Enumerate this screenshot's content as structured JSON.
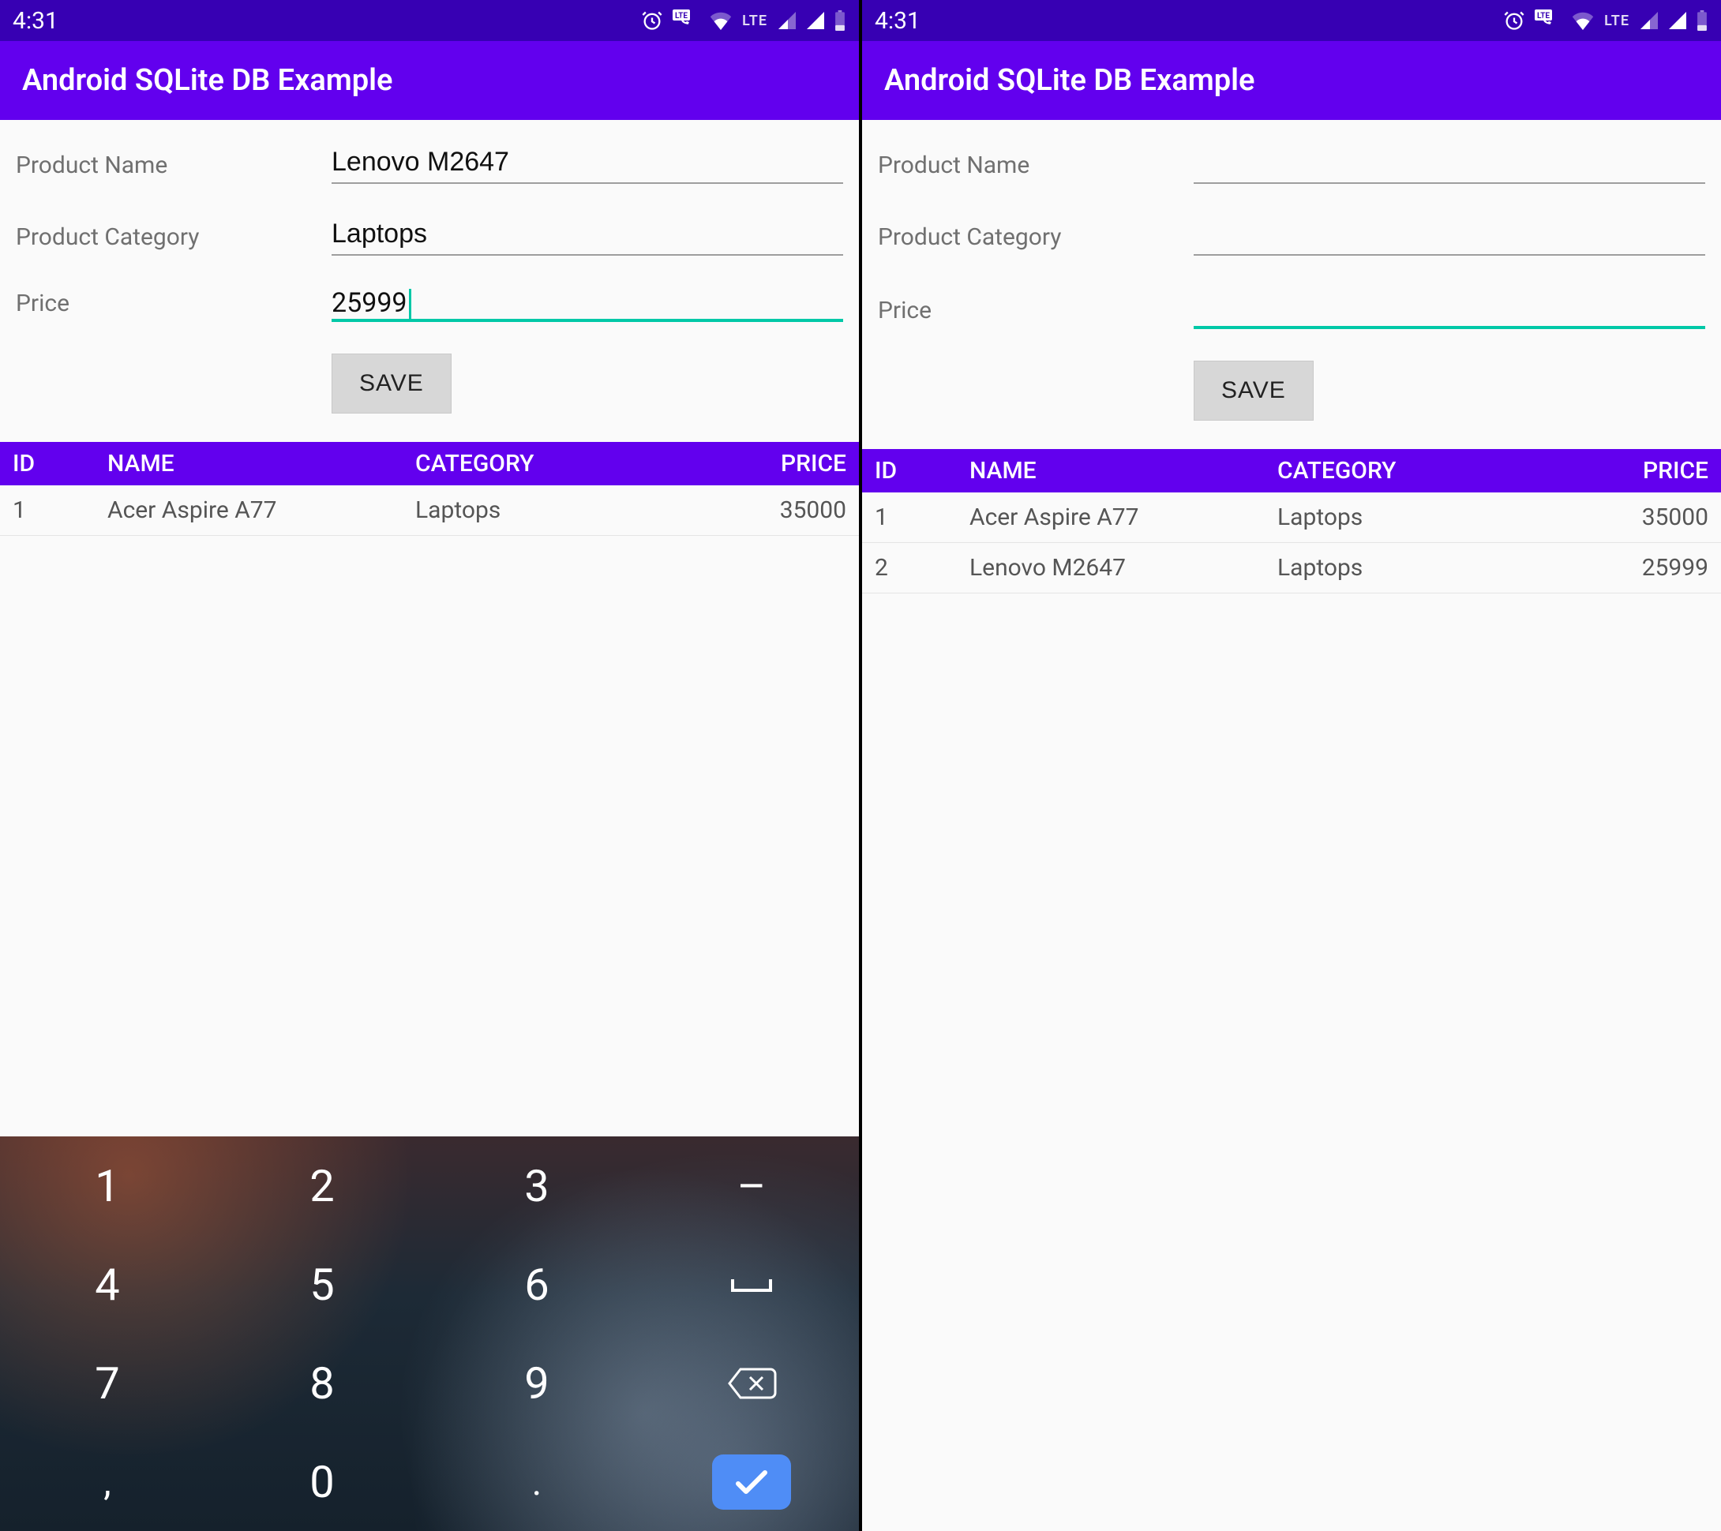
{
  "statusbar": {
    "time": "4:31",
    "lte": "LTE"
  },
  "appbar": {
    "title": "Android SQLite DB Example"
  },
  "form": {
    "labels": {
      "name": "Product Name",
      "category": "Product Category",
      "price": "Price"
    },
    "save_label": "SAVE"
  },
  "table": {
    "headers": {
      "id": "ID",
      "name": "NAME",
      "category": "CATEGORY",
      "price": "PRICE"
    }
  },
  "keypad": {
    "k1": "1",
    "k2": "2",
    "k3": "3",
    "kdash": "–",
    "k4": "4",
    "k5": "5",
    "k6": "6",
    "k7": "7",
    "k8": "8",
    "k9": "9",
    "kcomma": ",",
    "k0": "0",
    "kdot": "."
  },
  "screens": {
    "left": {
      "inputs": {
        "name": "Lenovo M2647",
        "category": "Laptops",
        "price": "25999"
      },
      "rows": [
        {
          "id": "1",
          "name": "Acer Aspire A77",
          "category": "Laptops",
          "price": "35000"
        }
      ]
    },
    "right": {
      "inputs": {
        "name": "",
        "category": "",
        "price": ""
      },
      "rows": [
        {
          "id": "1",
          "name": "Acer Aspire A77",
          "category": "Laptops",
          "price": "35000"
        },
        {
          "id": "2",
          "name": "Lenovo M2647",
          "category": "Laptops",
          "price": "25999"
        }
      ]
    }
  }
}
